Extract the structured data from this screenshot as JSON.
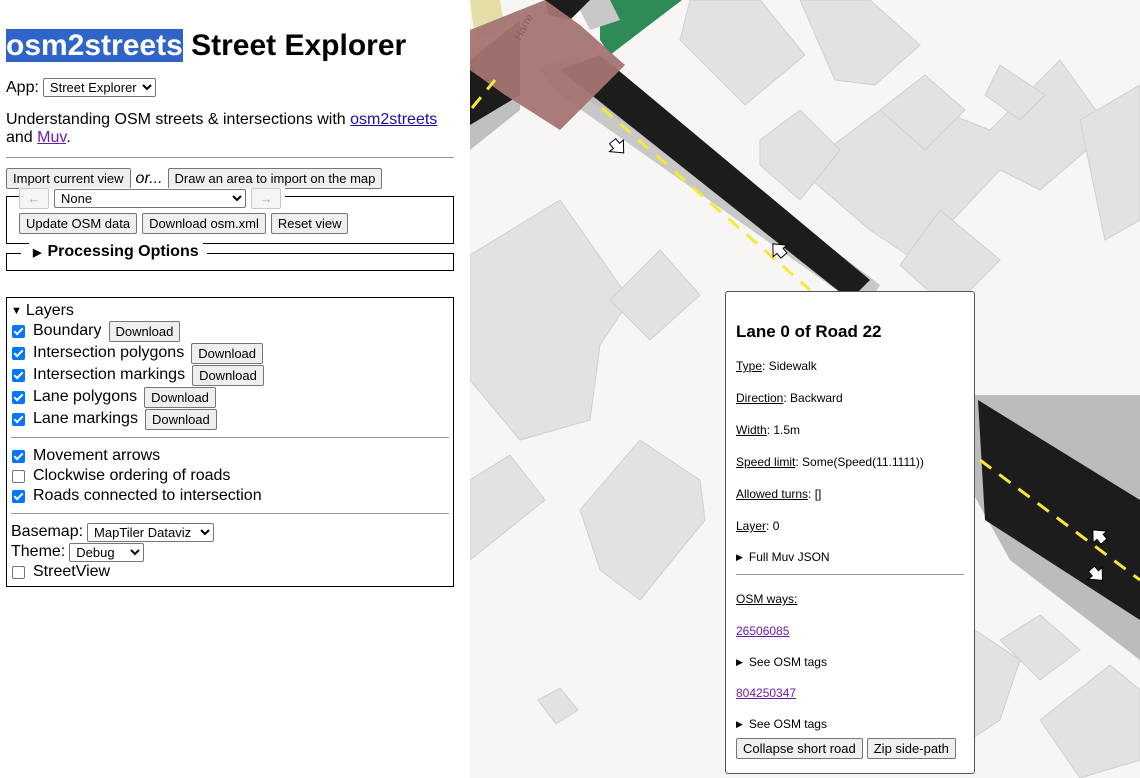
{
  "header": {
    "title_highlight": "osm2streets",
    "title_rest": "Street Explorer"
  },
  "app": {
    "label": "App:",
    "selected": "Street Explorer"
  },
  "intro": {
    "prefix": "Understanding OSM streets & intersections with ",
    "link1": "osm2streets",
    "middle": " and ",
    "link2": "Muv",
    "suffix": "."
  },
  "import": {
    "current_view": "Import current view",
    "or": "or...",
    "draw_area": "Draw an area to import on the map"
  },
  "nav": {
    "prev": "←",
    "next": "→",
    "selected": "None",
    "update": "Update OSM data",
    "download": "Download osm.xml",
    "reset": "Reset view"
  },
  "processing": {
    "label": "Processing Options"
  },
  "layers": {
    "title": "Layers",
    "download_label": "Download",
    "items": [
      {
        "label": "Boundary",
        "checked": true
      },
      {
        "label": "Intersection polygons",
        "checked": true
      },
      {
        "label": "Intersection markings",
        "checked": true
      },
      {
        "label": "Lane polygons",
        "checked": true
      },
      {
        "label": "Lane markings",
        "checked": true
      }
    ],
    "toggles": [
      {
        "label": "Movement arrows",
        "checked": true
      },
      {
        "label": "Clockwise ordering of roads",
        "checked": false
      },
      {
        "label": "Roads connected to intersection",
        "checked": true
      }
    ],
    "basemap_label": "Basemap:",
    "basemap_value": "MapTiler Dataviz",
    "theme_label": "Theme:",
    "theme_value": "Debug",
    "streetview_label": "StreetView",
    "streetview_checked": false
  },
  "popup": {
    "title": "Lane 0 of Road 22",
    "props": [
      {
        "key": "Type",
        "value": ": Sidewalk"
      },
      {
        "key": "Direction",
        "value": ": Backward"
      },
      {
        "key": "Width",
        "value": ": 1.5m"
      },
      {
        "key": "Speed limit",
        "value": ": Some(Speed(11.1111))"
      },
      {
        "key": "Allowed turns",
        "value": ": []"
      },
      {
        "key": "Layer",
        "value": ": 0"
      }
    ],
    "full_json": "Full Muv JSON",
    "osm_ways_label": "OSM ways:",
    "way1": "26506085",
    "way2": "804250347",
    "see_tags": "See OSM tags",
    "collapse": "Collapse short road",
    "zip": "Zip side-path"
  },
  "map": {
    "street_label": "Harre",
    "road_color": "#1c1c1c",
    "marking_color": "#f5e83a",
    "intersection_color": "#a47472",
    "building_color": "#e2e2e2",
    "background": "#f7f6f4"
  }
}
